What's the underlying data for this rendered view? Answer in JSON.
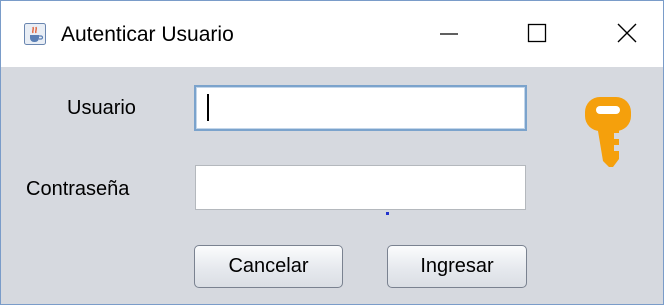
{
  "window": {
    "title": "Autenticar Usuario",
    "icons": {
      "app": "java-cup-icon",
      "minimize": "minimize-icon",
      "maximize": "maximize-icon",
      "close": "close-icon",
      "key": "key-icon"
    }
  },
  "form": {
    "username_label": "Usuario",
    "username_value": "",
    "password_label": "Contraseña",
    "password_value": ""
  },
  "buttons": {
    "cancel_label": "Cancelar",
    "submit_label": "Ingresar"
  },
  "colors": {
    "content_background": "#d6d9df",
    "key_icon": "#f5a00c",
    "focus_border": "#7ba3cc"
  }
}
